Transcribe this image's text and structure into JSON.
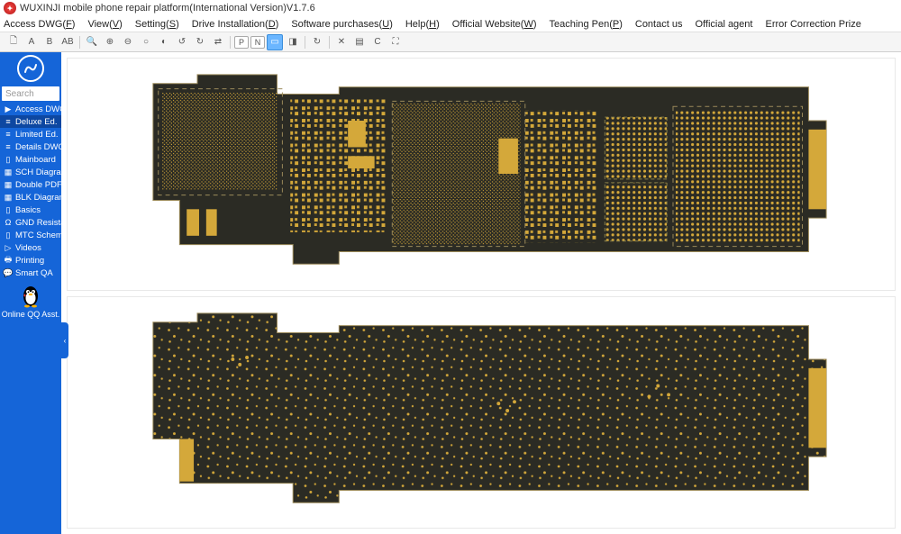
{
  "app": {
    "title": "WUXINJI mobile phone repair platform(International Version)V1.7.6"
  },
  "menu": [
    {
      "label": "Access DWG",
      "key": "F"
    },
    {
      "label": "View",
      "key": "V"
    },
    {
      "label": "Setting",
      "key": "S"
    },
    {
      "label": "Drive Installation",
      "key": "D"
    },
    {
      "label": "Software purchases",
      "key": "U"
    },
    {
      "label": "Help",
      "key": "H"
    },
    {
      "label": "Official Website",
      "key": "W"
    },
    {
      "label": "Teaching Pen",
      "key": "P"
    },
    {
      "label": "Contact us",
      "key": ""
    },
    {
      "label": "Official agent",
      "key": ""
    },
    {
      "label": "Error Correction Prize",
      "key": ""
    }
  ],
  "toolbar": [
    {
      "icon": "🗋",
      "name": "new-icon"
    },
    {
      "icon": "A",
      "name": "text-a-icon"
    },
    {
      "icon": "B",
      "name": "text-b-icon"
    },
    {
      "icon": "AB",
      "name": "text-ab-icon"
    },
    {
      "sep": true
    },
    {
      "icon": "🔍",
      "name": "zoom-icon"
    },
    {
      "icon": "⊕",
      "name": "zoom-in-icon"
    },
    {
      "icon": "⊖",
      "name": "zoom-out-icon"
    },
    {
      "icon": "○",
      "name": "circle-icon"
    },
    {
      "icon": "◐",
      "name": "half-circle-icon"
    },
    {
      "icon": "↺",
      "name": "rotate-ccw-icon"
    },
    {
      "icon": "↻",
      "name": "rotate-cw-icon"
    },
    {
      "icon": "⇄",
      "name": "flip-h-icon"
    },
    {
      "sep": true
    },
    {
      "icon": "P",
      "name": "p-tool-icon",
      "boxed": true
    },
    {
      "icon": "N",
      "name": "n-tool-icon",
      "boxed": true
    },
    {
      "icon": "▭",
      "name": "rect-tool-icon",
      "blue": true
    },
    {
      "icon": "◨",
      "name": "split-icon"
    },
    {
      "sep": true
    },
    {
      "icon": "↻",
      "name": "refresh-icon"
    },
    {
      "sep": true
    },
    {
      "icon": "✕",
      "name": "close-icon"
    },
    {
      "icon": "▤",
      "name": "list-icon"
    },
    {
      "icon": "C",
      "name": "c-tool-icon"
    },
    {
      "icon": "⛶",
      "name": "fullscreen-icon"
    }
  ],
  "sidebar": {
    "search_placeholder": "Search",
    "items": [
      {
        "icon": "▶",
        "label": "Access DWG",
        "name": "access-dwg"
      },
      {
        "icon": "≡",
        "label": "Deluxe Ed.",
        "name": "deluxe-ed",
        "active": true
      },
      {
        "icon": "≡",
        "label": "Limited Ed.",
        "name": "limited-ed"
      },
      {
        "icon": "≡",
        "label": "Details DWG",
        "name": "details-dwg"
      },
      {
        "icon": "▯",
        "label": "Mainboard",
        "name": "mainboard"
      },
      {
        "icon": "▦",
        "label": "SCH Diagram",
        "name": "sch-diagram"
      },
      {
        "icon": "▦",
        "label": "Double PDF",
        "name": "double-pdf"
      },
      {
        "icon": "▦",
        "label": "BLK Diagram",
        "name": "blk-diagram"
      },
      {
        "icon": "▯",
        "label": "Basics",
        "name": "basics"
      },
      {
        "icon": "Ω",
        "label": "GND Resistance",
        "name": "gnd-resist"
      },
      {
        "icon": "▯",
        "label": "MTC Scheme",
        "name": "mtc-schem"
      },
      {
        "icon": "▷",
        "label": "Videos",
        "name": "videos"
      },
      {
        "icon": "🖶",
        "label": "Printing",
        "name": "printing"
      },
      {
        "icon": "💬",
        "label": "Smart QA",
        "name": "smart-qa"
      }
    ],
    "qq_label": "Online QQ Asst."
  }
}
